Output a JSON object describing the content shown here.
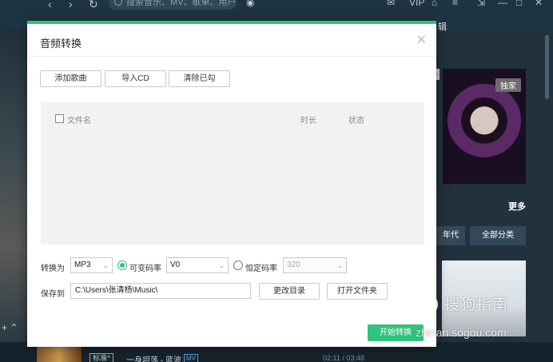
{
  "app": {
    "search_placeholder": "搜索音乐、MV、歌单、用户",
    "top_icons": [
      "mail-icon",
      "vip",
      "shirt-icon",
      "menu-icon",
      "mini-mode-icon",
      "minimize-icon",
      "maximize-icon",
      "close-icon"
    ],
    "vip_label": "VIP",
    "section_label": "辑",
    "album_tag": "独家",
    "side_tag": "ᴬ",
    "more_label": "更多",
    "categories": [
      "年代",
      "全部分类"
    ],
    "now_playing": {
      "quality": "标准^",
      "title": "一身坦荡 - 蓝波",
      "mv_badge": "MV",
      "time": "02:11 / 03:48"
    }
  },
  "dialog": {
    "title": "音频转换",
    "buttons": {
      "add_songs": "添加歌曲",
      "import_cd": "导入CD",
      "clear_checked": "清除已勾"
    },
    "columns": {
      "filename": "文件名",
      "duration": "时长",
      "status": "状态"
    },
    "convert_label": "转换为",
    "format_value": "MP3",
    "vbr_label": "可变码率",
    "vbr_value": "V0",
    "cbr_label": "恒定码率",
    "cbr_value": "320",
    "save_label": "保存到",
    "save_path": "C:\\Users\\张清杨\\Music\\",
    "change_dir": "更改目录",
    "open_folder": "打开文件夹",
    "start": "开始转换"
  },
  "watermark": {
    "main": "搜狗指南",
    "sub": "zhinan.sogou.com"
  },
  "colors": {
    "accent": "#31c27c",
    "app_bg": "#1c2b36"
  }
}
